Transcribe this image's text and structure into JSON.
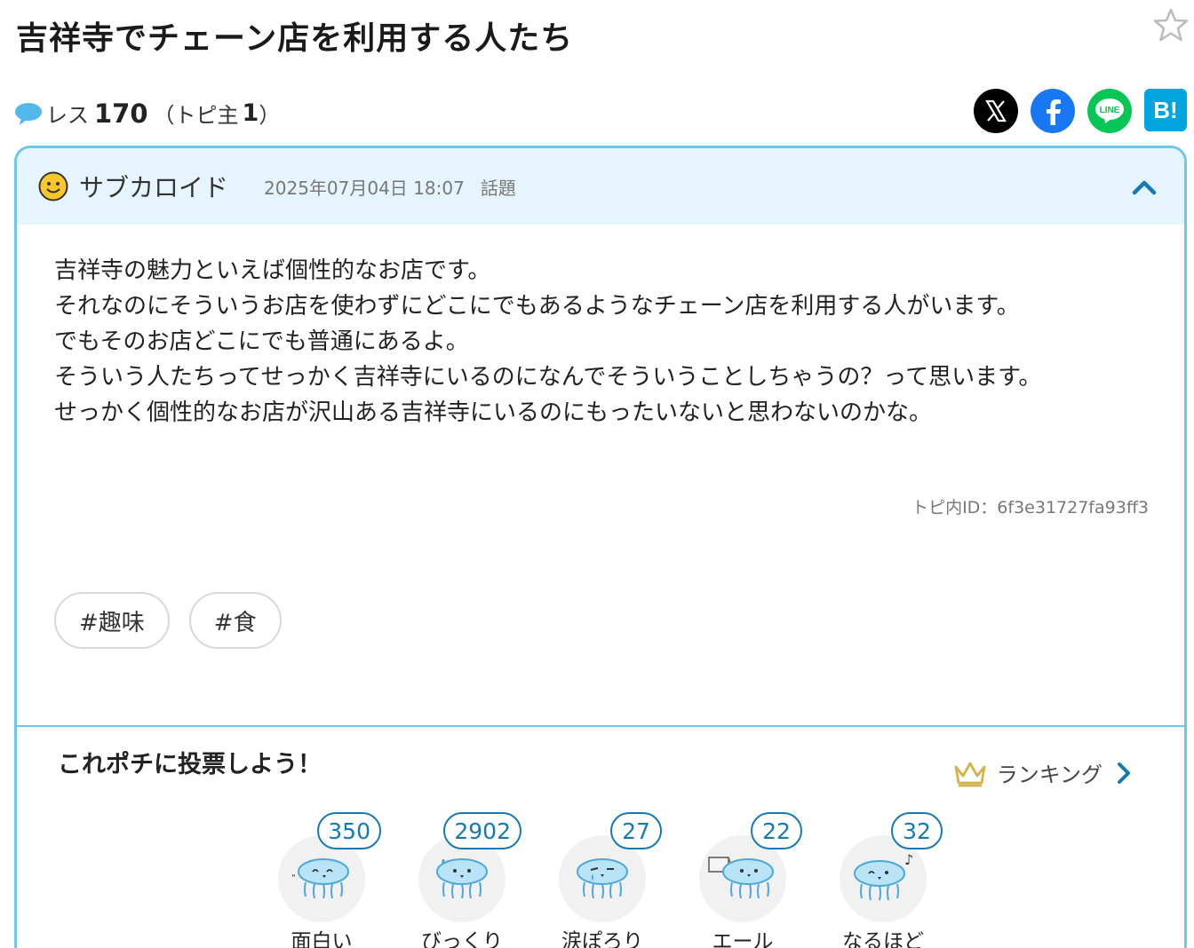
{
  "topic": {
    "title": "吉祥寺でチェーン店を利用する人たち",
    "res_label": "レス",
    "res_count": "170",
    "owner_prefix": "（トピ主",
    "owner_count": "1",
    "owner_suffix": "）"
  },
  "post": {
    "author": "サブカロイド",
    "date": "2025年07月04日 18:07",
    "category": "話題",
    "body": [
      "吉祥寺の魅力といえば個性的なお店です。",
      "それなのにそういうお店を使わずにどこにでもあるようなチェーン店を利用する人がいます。",
      "でもそのお店どこにでも普通にあるよ。",
      "そういう人たちってせっかく吉祥寺にいるのになんでそういうことしちゃうの？って思います。",
      "せっかく個性的なお店が沢山ある吉祥寺にいるのにもったいないと思わないのかな。"
    ],
    "topic_id": "トピ内ID：6f3e31727fa93ff3",
    "tags": [
      "#趣味",
      "#食"
    ]
  },
  "voting": {
    "title": "これポチに投票しよう！",
    "ranking_label": "ランキング",
    "items": [
      {
        "label": "面白い",
        "count": "350"
      },
      {
        "label": "びっくり",
        "count": "2902"
      },
      {
        "label": "涙ぽろり",
        "count": "27"
      },
      {
        "label": "エール",
        "count": "22"
      },
      {
        "label": "なるほど",
        "count": "32"
      }
    ]
  },
  "share": {
    "hatena_label": "B!"
  },
  "colors": {
    "accent_border": "#6cc6ee",
    "header_bg": "#e6f5fd",
    "count_blue": "#1779b4"
  }
}
